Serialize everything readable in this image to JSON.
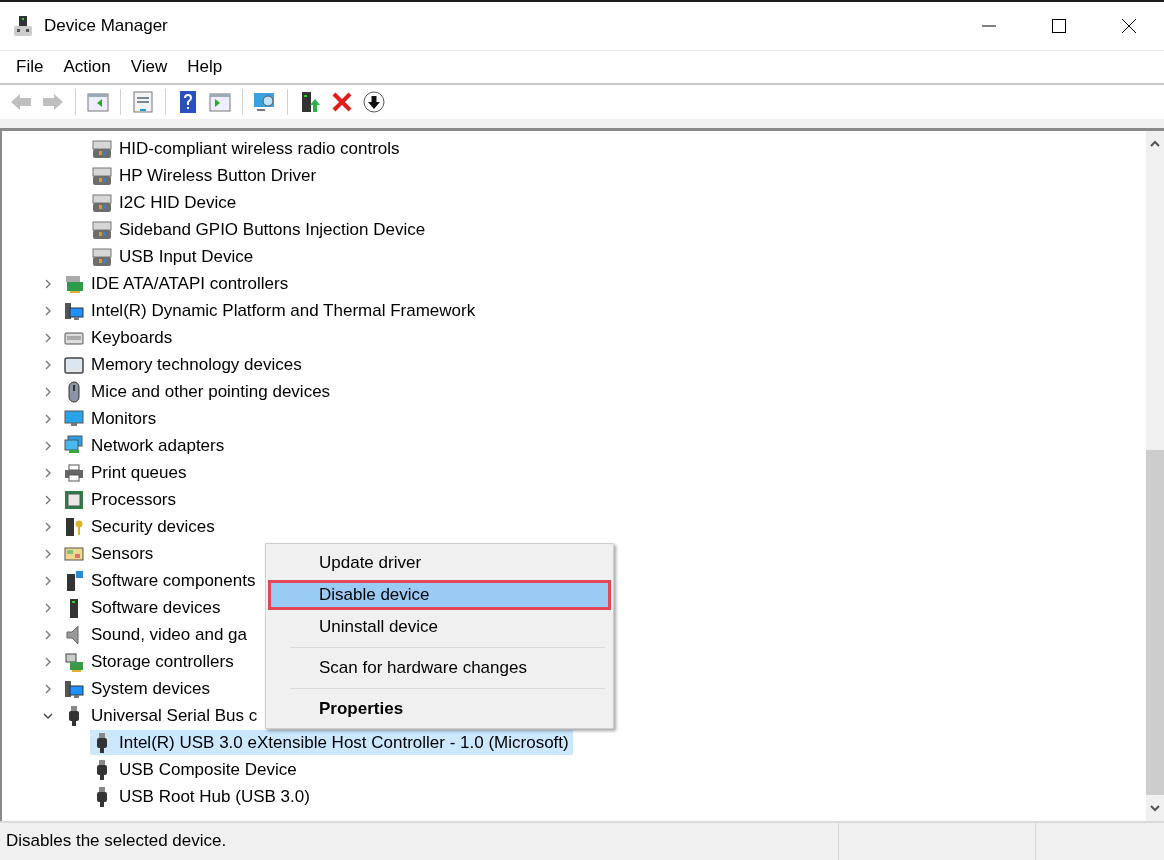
{
  "window": {
    "title": "Device Manager"
  },
  "menu_bar": [
    {
      "label": "File"
    },
    {
      "label": "Action"
    },
    {
      "label": "View"
    },
    {
      "label": "Help"
    }
  ],
  "toolbar": [
    [
      {
        "disabled": true
      },
      {
        "disabled": true
      }
    ],
    [
      {
        "disabled": false
      }
    ],
    [
      {
        "disabled": false
      }
    ],
    [
      {
        "disabled": false
      },
      {
        "disabled": false
      }
    ],
    [
      {
        "disabled": false
      }
    ],
    [
      {
        "disabled": false
      },
      {
        "disabled": false
      },
      {
        "disabled": false
      }
    ]
  ],
  "tree": [
    {
      "children": [
        {
          "label": "HID-compliant wireless radio controls",
          "selected": false
        },
        {
          "label": "HP Wireless Button Driver",
          "selected": false
        },
        {
          "label": "I2C HID Device",
          "selected": false
        },
        {
          "label": "Sideband GPIO Buttons Injection Device",
          "selected": false
        },
        {
          "label": "USB Input Device",
          "selected": false
        }
      ]
    },
    {
      "label": "IDE ATA/ATAPI controllers",
      "expanded": false,
      "selected": false
    },
    {
      "label": "Intel(R) Dynamic Platform and Thermal Framework",
      "expanded": false,
      "selected": false
    },
    {
      "label": "Keyboards",
      "expanded": false,
      "selected": false
    },
    {
      "label": "Memory technology devices",
      "expanded": false,
      "selected": false
    },
    {
      "label": "Mice and other pointing devices",
      "expanded": false,
      "selected": false
    },
    {
      "label": "Monitors",
      "expanded": false,
      "selected": false
    },
    {
      "label": "Network adapters",
      "expanded": false,
      "selected": false
    },
    {
      "label": "Print queues",
      "expanded": false,
      "selected": false
    },
    {
      "label": "Processors",
      "expanded": false,
      "selected": false
    },
    {
      "label": "Security devices",
      "expanded": false,
      "selected": false
    },
    {
      "label": "Sensors",
      "expanded": false,
      "selected": false
    },
    {
      "label": "Software components",
      "expanded": false,
      "selected": false
    },
    {
      "label": "Software devices",
      "expanded": false,
      "selected": false
    },
    {
      "label": "Sound, video and ga",
      "expanded": false,
      "selected": false
    },
    {
      "label": "Storage controllers",
      "expanded": false,
      "selected": false
    },
    {
      "label": "System devices",
      "expanded": false,
      "selected": false
    },
    {
      "label": "Universal Serial Bus c",
      "expanded": true,
      "selected": false,
      "children": [
        {
          "label": "Intel(R) USB 3.0 eXtensible Host Controller - 1.0 (Microsoft)",
          "selected": true
        },
        {
          "label": "USB Composite Device",
          "selected": false
        },
        {
          "label": "USB Root Hub (USB 3.0)",
          "selected": false
        }
      ]
    }
  ],
  "context_menu": [
    {
      "kind": "item",
      "label": "Update driver",
      "selected": false,
      "annotated": false,
      "default": false
    },
    {
      "kind": "item",
      "label": "Disable device",
      "selected": true,
      "annotated": true,
      "default": false
    },
    {
      "kind": "item",
      "label": "Uninstall device",
      "selected": false,
      "annotated": false,
      "default": false
    },
    {
      "kind": "separator"
    },
    {
      "kind": "item",
      "label": "Scan for hardware changes",
      "selected": false,
      "annotated": false,
      "default": false
    },
    {
      "kind": "separator"
    },
    {
      "kind": "item",
      "label": "Properties",
      "selected": false,
      "annotated": false,
      "default": true
    }
  ],
  "status_bar": {
    "text": "Disables the selected device."
  }
}
